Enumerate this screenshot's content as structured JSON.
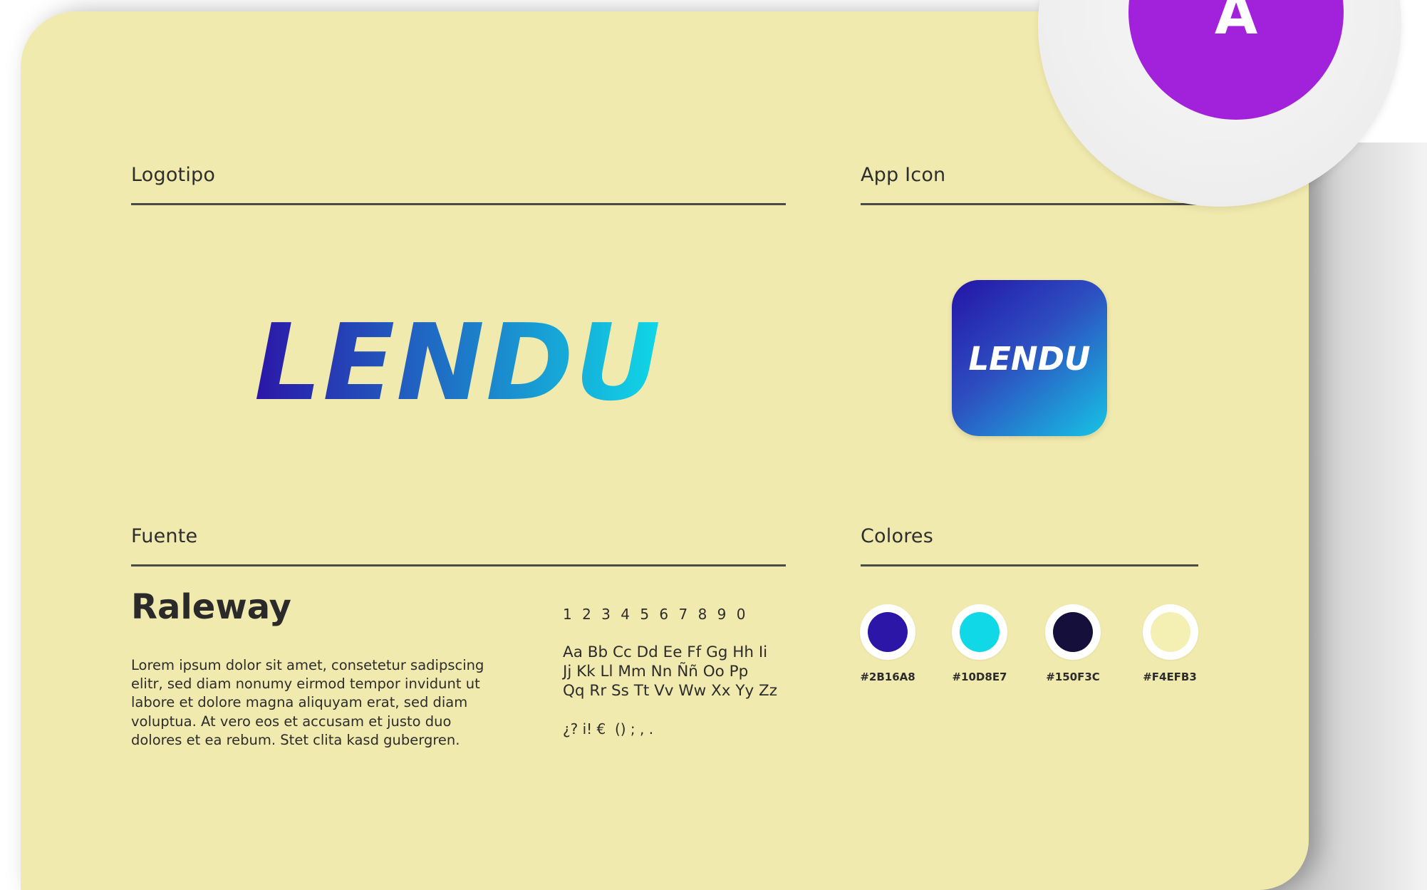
{
  "sections": {
    "logotipo": "Logotipo",
    "app_icon": "App Icon",
    "fuente": "Fuente",
    "colores": "Colores"
  },
  "brand": {
    "wordmark": "LENDU",
    "gradient_start": "#2B16A8",
    "gradient_end": "#10D8E7"
  },
  "font": {
    "name": "Raleway",
    "sample": "Lorem ipsum dolor sit amet, consetetur sadipscing elitr, sed diam nonumy eirmod tempor invidunt ut labore et dolore magna aliquyam erat, sed diam voluptua. At vero eos et accusam et justo duo dolores et ea rebum. Stet clita kasd gubergren.",
    "digits": "1 2 3 4 5 6 7 8 9 0",
    "alphabet_lines": [
      "Aa Bb Cc Dd Ee Ff Gg Hh Ii",
      "Jj Kk Ll Mm Nn Ññ Oo Pp",
      "Qq Rr Ss Tt Vv Ww Xx Yy Zz"
    ],
    "symbols": "¿? i! €  () ; , ."
  },
  "colors": [
    {
      "label": "#2B16A8",
      "hex": "#2B16A8"
    },
    {
      "label": "#10D8E7",
      "hex": "#10D8E7"
    },
    {
      "label": "#150F3C",
      "hex": "#150F3C"
    },
    {
      "label": "#F4EFB3",
      "hex": "#F4EFB3"
    }
  ],
  "badge": {
    "letter": "A",
    "color": "#A222DC"
  }
}
